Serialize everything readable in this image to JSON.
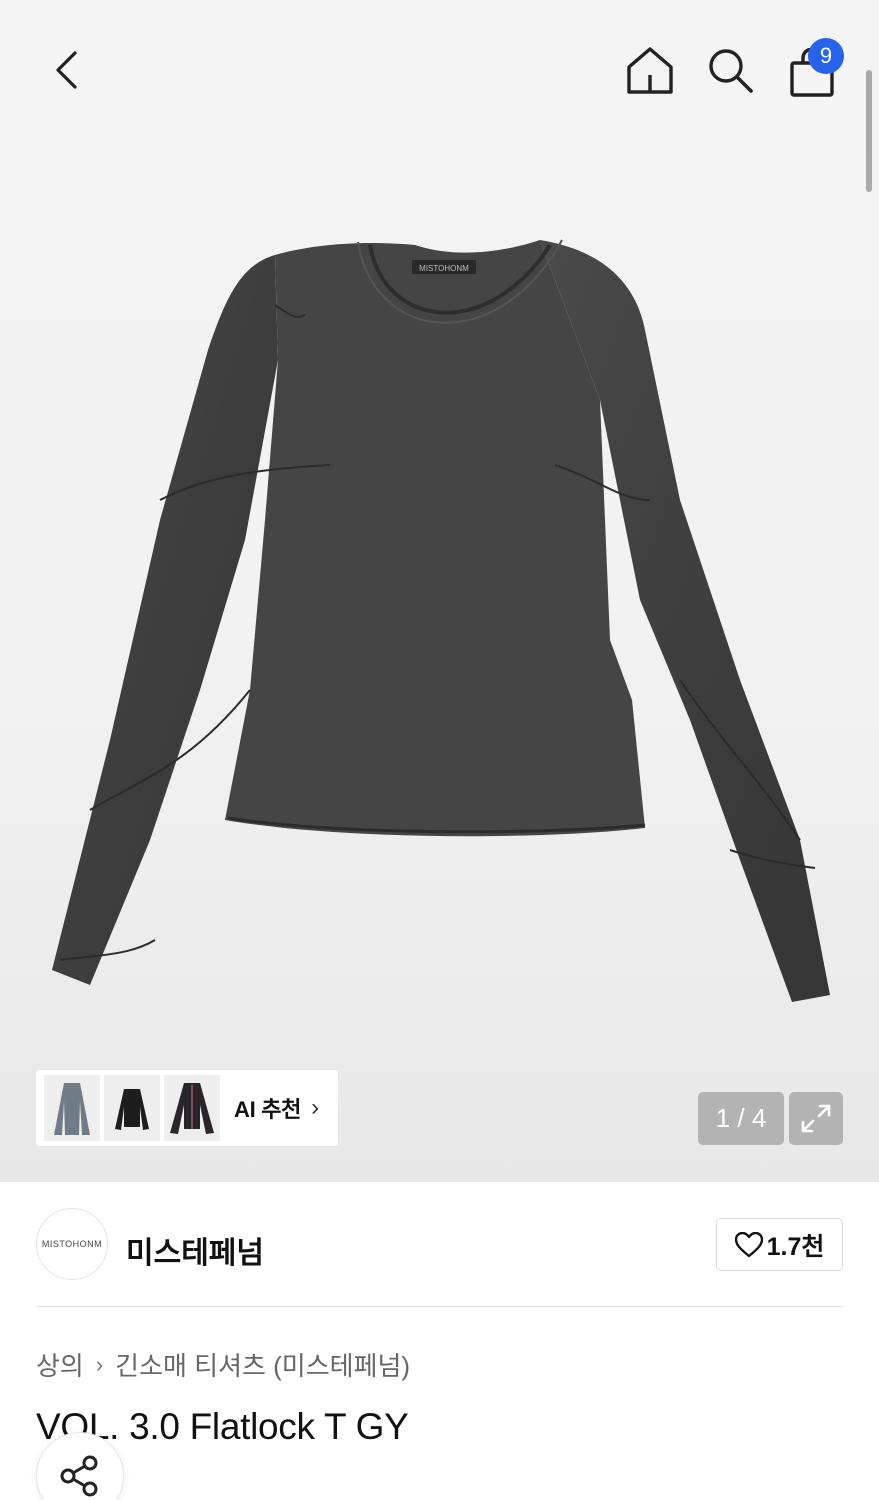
{
  "header": {
    "back_icon": "chevron-left-icon",
    "home_icon": "home-icon",
    "search_icon": "search-icon",
    "cart_icon": "shopping-bag-icon",
    "cart_count": "9",
    "badge_color": "#2563eb"
  },
  "gallery": {
    "current": "1",
    "total": "4",
    "counter_text": "1 / 4",
    "expand_icon": "expand-icon"
  },
  "ai_recommend": {
    "label": "AI 추천",
    "chevron": "›"
  },
  "brand": {
    "logo_text": "MISTOHONM",
    "name": "미스테페넘",
    "like_count": "1.7천",
    "like_icon": "heart-icon"
  },
  "breadcrumb": {
    "level1": "상의",
    "separator": "›",
    "level2": "긴소매 티셔츠 (미스테페넘)"
  },
  "product": {
    "title": "VOL. 3.0 Flatlock T GY",
    "image_label": "MISTOHONM"
  },
  "share_icon": "share-icon"
}
